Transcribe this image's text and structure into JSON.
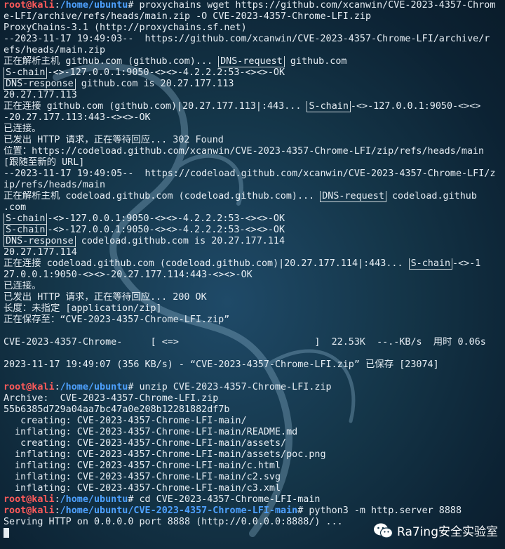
{
  "prompt": {
    "user": "root@kali",
    "sep": ":",
    "home_path": "/home/ubuntu",
    "repo_path": "/home/ubuntu/CVE-2023-4357-Chrome-LFI-main",
    "symbol": "#"
  },
  "lines": [
    {
      "type": "cmd",
      "path": "/home/ubuntu",
      "text": " proxychains wget https://github.com/xcanwin/CVE-2023-4357-Chrom"
    },
    {
      "text": "e-LFI/archive/refs/heads/main.zip -O CVE-2023-4357-Chrome-LFI.zip"
    },
    {
      "text": "ProxyChains-3.1 (http://proxychains.sf.net)"
    },
    {
      "text": "--2023-11-17 19:49:03--  https://github.com/xcanwin/CVE-2023-4357-Chrome-LFI/archive/r"
    },
    {
      "text": "efs/heads/main.zip"
    },
    {
      "text": "正在解析主机 github.com (github.com)... |DNS-request| github.com"
    },
    {
      "text": "|S-chain|-<>-127.0.0.1:9050-<><>-4.2.2.2:53-<><>-OK"
    },
    {
      "text": "|DNS-response| github.com is 20.27.177.113"
    },
    {
      "text": "20.27.177.113"
    },
    {
      "text": "正在连接 github.com (github.com)|20.27.177.113|:443... |S-chain|-<>-127.0.0.1:9050-<><>"
    },
    {
      "text": "-20.27.177.113:443-<><>-OK"
    },
    {
      "text": "已连接。"
    },
    {
      "text": "已发出 HTTP 请求，正在等待回应... 302 Found"
    },
    {
      "text": "位置：https://codeload.github.com/xcanwin/CVE-2023-4357-Chrome-LFI/zip/refs/heads/main"
    },
    {
      "text": "[跟随至新的 URL]"
    },
    {
      "text": "--2023-11-17 19:49:05--  https://codeload.github.com/xcanwin/CVE-2023-4357-Chrome-LFI/z"
    },
    {
      "text": "ip/refs/heads/main"
    },
    {
      "text": "正在解析主机 codeload.github.com (codeload.github.com)... |DNS-request| codeload.github"
    },
    {
      "text": ".com"
    },
    {
      "text": "|S-chain|-<>-127.0.0.1:9050-<><>-4.2.2.2:53-<><>-OK"
    },
    {
      "text": "|S-chain|-<>-127.0.0.1:9050-<><>-4.2.2.2:53-<><>-OK"
    },
    {
      "text": "|DNS-response| codeload.github.com is 20.27.177.114"
    },
    {
      "text": "20.27.177.114"
    },
    {
      "text": "正在连接 codeload.github.com (codeload.github.com)|20.27.177.114|:443... |S-chain|-<>-1"
    },
    {
      "text": "27.0.0.1:9050-<><>-20.27.177.114:443-<><>-OK"
    },
    {
      "text": "已连接。"
    },
    {
      "text": "已发出 HTTP 请求，正在等待回应... 200 OK"
    },
    {
      "text": "长度：未指定 [application/zip]"
    },
    {
      "text": "正在保存至：“CVE-2023-4357-Chrome-LFI.zip”"
    },
    {
      "text": ""
    },
    {
      "text": "CVE-2023-4357-Chrome-     [ <=>                        ]  22.53K  --.-KB/s  用时 0.06s"
    },
    {
      "text": ""
    },
    {
      "text": "2023-11-17 19:49:07 (356 KB/s) - “CVE-2023-4357-Chrome-LFI.zip” 已保存 [23074]"
    },
    {
      "text": ""
    },
    {
      "type": "cmd",
      "path": "/home/ubuntu",
      "text": " unzip CVE-2023-4357-Chrome-LFI.zip"
    },
    {
      "text": "Archive:  CVE-2023-4357-Chrome-LFI.zip"
    },
    {
      "text": "55b6385d729a04aa7bc47a0e208b12281882df7b"
    },
    {
      "text": "   creating: CVE-2023-4357-Chrome-LFI-main/"
    },
    {
      "text": "  inflating: CVE-2023-4357-Chrome-LFI-main/README.md"
    },
    {
      "text": "   creating: CVE-2023-4357-Chrome-LFI-main/assets/"
    },
    {
      "text": "  inflating: CVE-2023-4357-Chrome-LFI-main/assets/poc.png"
    },
    {
      "text": "  inflating: CVE-2023-4357-Chrome-LFI-main/c.html"
    },
    {
      "text": "  inflating: CVE-2023-4357-Chrome-LFI-main/c2.svg"
    },
    {
      "text": "  inflating: CVE-2023-4357-Chrome-LFI-main/c3.xml"
    },
    {
      "type": "cmd",
      "path": "/home/ubuntu",
      "text": " cd CVE-2023-4357-Chrome-LFI-main"
    },
    {
      "type": "cmd",
      "path": "/home/ubuntu/CVE-2023-4357-Chrome-LFI-main",
      "text": " python3 -m http.server 8888"
    },
    {
      "text": "Serving HTTP on 0.0.0.0 port 8888 (http://0.0.0.0:8888/) ..."
    }
  ],
  "watermark": {
    "text": "Ra7ing安全实验室",
    "icon": "wechat-icon"
  },
  "colors": {
    "prompt_user": "#ff5a5a",
    "prompt_path": "#4ea1ff",
    "text": "#e6edf3",
    "background": "#143548"
  }
}
